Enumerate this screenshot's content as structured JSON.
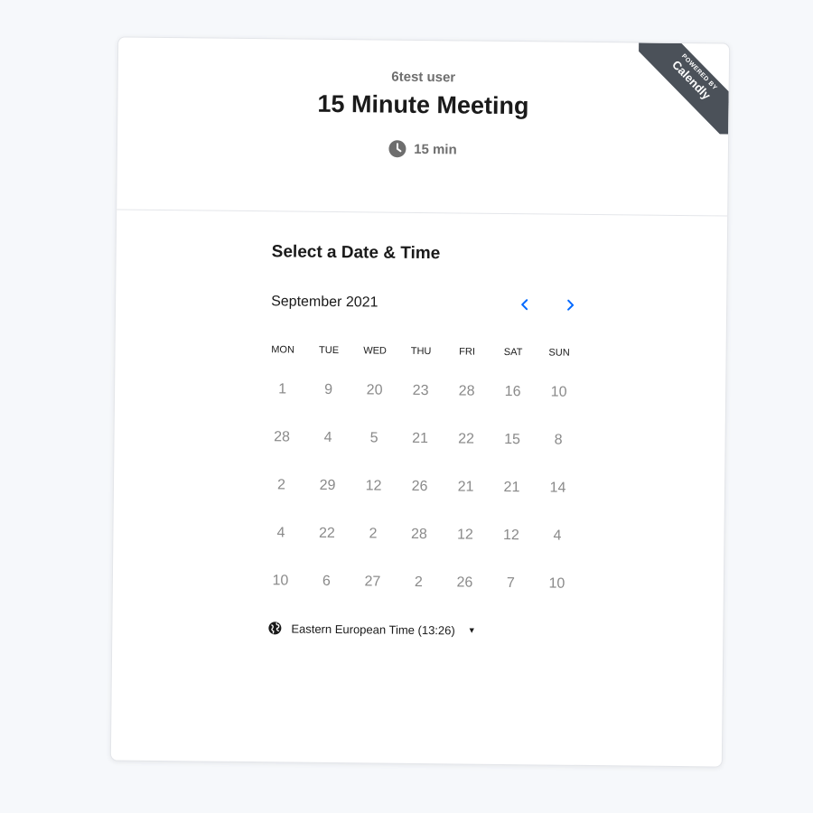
{
  "header": {
    "host_name": "6test user",
    "event_title": "15 Minute Meeting",
    "duration": "15 min",
    "ribbon_small": "POWERED BY",
    "ribbon_brand": "Calendly"
  },
  "scheduler": {
    "section_title": "Select a Date & Time",
    "month_label": "September 2021",
    "prev_icon": "chevron-left-icon",
    "next_icon": "chevron-right-icon",
    "weekdays": [
      "MON",
      "TUE",
      "WED",
      "THU",
      "FRI",
      "SAT",
      "SUN"
    ],
    "weeks": [
      [
        "1",
        "9",
        "20",
        "23",
        "28",
        "16",
        "10"
      ],
      [
        "28",
        "4",
        "5",
        "21",
        "22",
        "15",
        "8"
      ],
      [
        "2",
        "29",
        "12",
        "26",
        "21",
        "21",
        "14"
      ],
      [
        "4",
        "22",
        "2",
        "28",
        "12",
        "12",
        "4"
      ],
      [
        "10",
        "6",
        "27",
        "2",
        "26",
        "7",
        "10"
      ]
    ]
  },
  "timezone": {
    "label": "Eastern European Time",
    "time": "(13:26)",
    "icon": "globe-icon"
  },
  "colors": {
    "accent": "#0069ff",
    "ribbon": "#4b5159",
    "muted_text": "#8a8a8a"
  }
}
